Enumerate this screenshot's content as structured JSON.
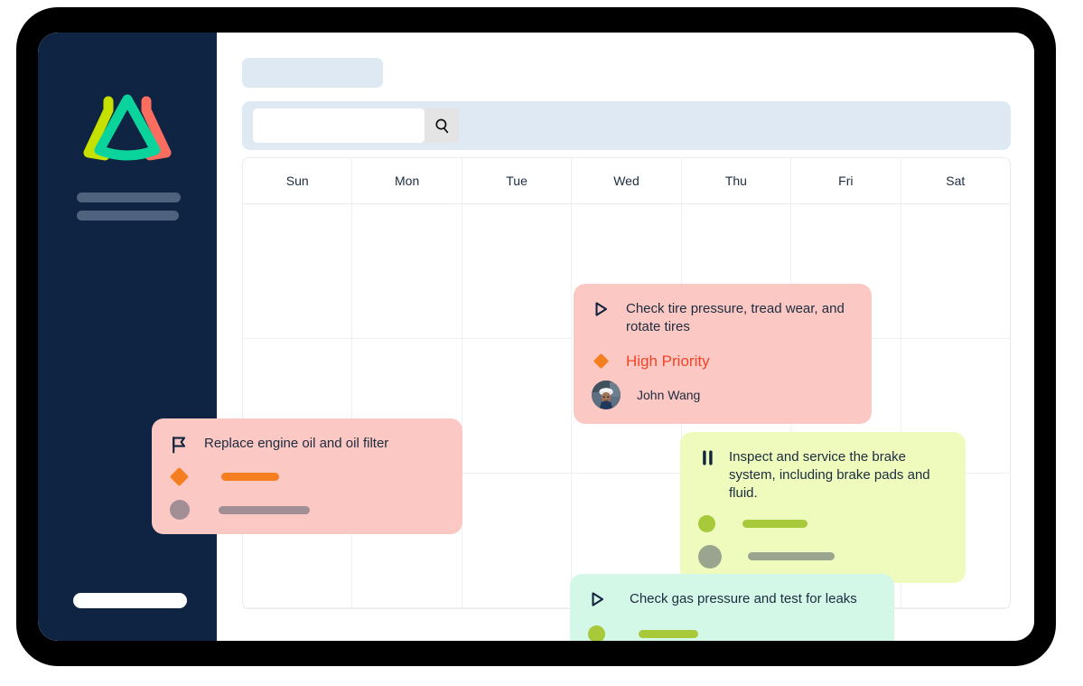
{
  "app": {
    "logo_name": "mountain-logo",
    "sidebar_nav_placeholder_count": 2,
    "sidebar_bottom_pill": "bottom-pill"
  },
  "header": {
    "title_placeholder": "title-placeholder",
    "search": {
      "value": "",
      "placeholder": "",
      "button_icon": "search-icon",
      "button_label": "Search"
    }
  },
  "calendar": {
    "day_headers": [
      "Sun",
      "Mon",
      "Tue",
      "Wed",
      "Thu",
      "Fri",
      "Sat"
    ],
    "rows": 3,
    "columns": 7
  },
  "events": [
    {
      "id": "tire",
      "icon": "play-outline-icon",
      "title": "Check tire pressure, tread wear, and rotate tires",
      "priority": {
        "icon": "diamond-icon",
        "label": "High Priority",
        "color": "#ef4526"
      },
      "assignee": {
        "name": "John Wang",
        "avatar": "worker-avatar"
      },
      "color": "#fcc8c4",
      "day": "Wed"
    },
    {
      "id": "oil",
      "icon": "flag-icon",
      "title": "Replace engine oil and oil filter",
      "priority": {
        "icon": "diamond-icon",
        "label": "",
        "color": "#f47e20"
      },
      "assignee": {
        "name": "",
        "avatar": "generic-avatar"
      },
      "color": "#fcc8c4",
      "day": "Sun"
    },
    {
      "id": "brake",
      "icon": "pause-icon",
      "title": "Inspect and service the brake system, including brake pads and fluid.",
      "priority": {
        "icon": "dot-icon",
        "label": "",
        "color": "#a8c93a"
      },
      "assignee": {
        "name": "",
        "avatar": "generic-avatar"
      },
      "color": "#eefbbd",
      "day": "Thu"
    },
    {
      "id": "gas",
      "icon": "play-outline-icon",
      "title": "Check gas pressure and test for leaks",
      "priority": {
        "icon": "dot-icon",
        "label": "",
        "color": "#a8c93a"
      },
      "assignee": {
        "name": "",
        "avatar": "generic-avatar"
      },
      "color": "#d4f8e8",
      "day": "Wed"
    }
  ],
  "colors": {
    "sidebar": "#0f2443",
    "accent_blue_placeholder": "#dfe9f3",
    "pink_event": "#fcc8c4",
    "lime_event": "#eefbbd",
    "mint_event": "#d4f8e8",
    "priority_orange": "#ef4526",
    "logo_green": "#c6e000",
    "logo_teal": "#0ad49b",
    "logo_salmon": "#fa6d5f"
  }
}
